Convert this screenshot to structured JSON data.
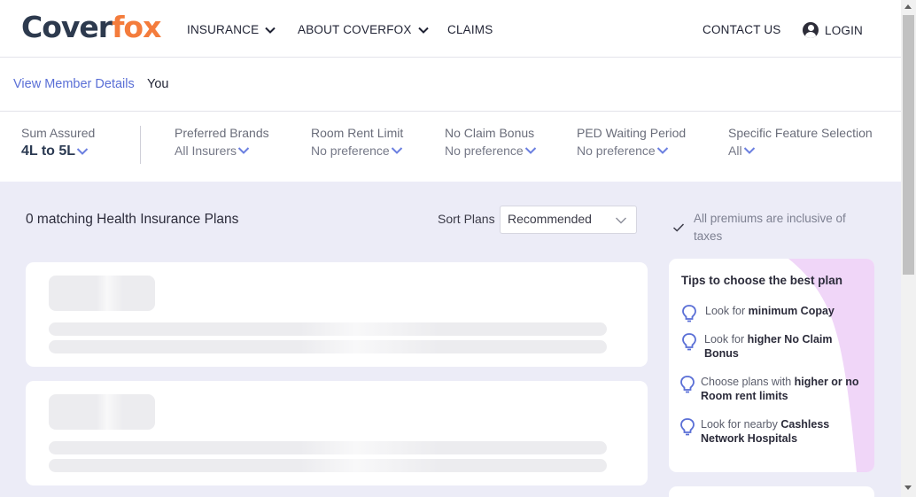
{
  "header": {
    "logo_main": "Cover",
    "logo_accent": "fox",
    "nav": [
      "INSURANCE",
      "ABOUT COVERFOX",
      "CLAIMS"
    ],
    "contact": "CONTACT US",
    "login": "LOGIN"
  },
  "members": {
    "link": "View Member Details",
    "value": "You"
  },
  "filters": [
    {
      "label": "Sum Assured",
      "value": "4L to 5L"
    },
    {
      "label": "Preferred Brands",
      "value": "All Insurers"
    },
    {
      "label": "Room Rent Limit",
      "value": "No preference"
    },
    {
      "label": "No Claim Bonus",
      "value": "No preference"
    },
    {
      "label": "PED Waiting Period",
      "value": "No preference"
    },
    {
      "label": "Specific Feature Selection",
      "value": "All"
    }
  ],
  "results": {
    "count_text": "0 matching Health Insurance Plans",
    "sort_label": "Sort Plans",
    "sort_value": "Recommended",
    "premium_note": "All premiums are inclusive of taxes"
  },
  "tips": {
    "title": "Tips to choose the best plan",
    "items": [
      {
        "prefix": "Look for ",
        "bold": "minimum Copay",
        "suffix": ""
      },
      {
        "prefix": "Look for ",
        "bold": "higher No Claim Bonus",
        "suffix": ""
      },
      {
        "prefix": "Choose plans with ",
        "bold": "higher or no Room rent limits",
        "suffix": ""
      },
      {
        "prefix": "Look for nearby ",
        "bold": "Cashless Network Hospitals",
        "suffix": ""
      }
    ]
  },
  "colors": {
    "brand_dark": "#2d3a4e",
    "brand_orange": "#f47c3c",
    "link_blue": "#5a6fd6",
    "chevron_blue": "#6b7fe0",
    "main_bg": "#ececf7",
    "tips_accent": "#f0d6f8"
  },
  "icons": [
    "chevron-down-icon",
    "user-icon",
    "check-icon",
    "bulb-icon"
  ]
}
